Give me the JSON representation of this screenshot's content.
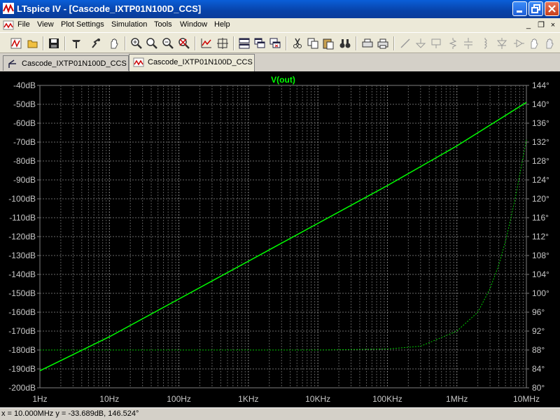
{
  "window": {
    "title": "LTspice IV - [Cascode_IXTP01N100D_CCS]",
    "accent": "#0a5fd8"
  },
  "menu": {
    "items": [
      "File",
      "View",
      "Plot Settings",
      "Simulation",
      "Tools",
      "Window",
      "Help"
    ],
    "mdi_buttons": [
      "_",
      "❐",
      "×"
    ]
  },
  "toolbar": {
    "icons": [
      "new-schematic-icon",
      "open-icon",
      "save-icon",
      "control-panel-icon",
      "run-icon",
      "pan-icon",
      "zoom-in-icon",
      "zoom-box-icon",
      "zoom-out-icon",
      "zoom-cancel-icon",
      "autorange-icon",
      "mark-plot-icon",
      "tile-horizontal-icon",
      "cascade-icon",
      "close-all-icon",
      "cut-icon",
      "copy-icon",
      "paste-icon",
      "find-icon",
      "print-setup-icon",
      "print-icon",
      "wire-icon",
      "ground-icon",
      "label-icon",
      "resistor-icon",
      "capacitor-icon",
      "inductor-icon",
      "diode-icon",
      "component-icon",
      "move-icon",
      "drag-icon"
    ]
  },
  "tabs": [
    {
      "label": "Cascode_IXTP01N100D_CCS",
      "active": false
    },
    {
      "label": "Cascode_IXTP01N100D_CCS",
      "active": true
    }
  ],
  "chart_data": {
    "type": "line",
    "title": "V(out)",
    "x_scale": "log",
    "xlim_hz": [
      1,
      10000000
    ],
    "x_tick_labels": [
      "1Hz",
      "10Hz",
      "100Hz",
      "1KHz",
      "10KHz",
      "100KHz",
      "1MHz",
      "10MHz"
    ],
    "y_left": {
      "range_db": [
        -200,
        -40
      ],
      "tick_labels": [
        "-40dB",
        "-50dB",
        "-60dB",
        "-70dB",
        "-80dB",
        "-90dB",
        "-100dB",
        "-110dB",
        "-120dB",
        "-130dB",
        "-140dB",
        "-150dB",
        "-160dB",
        "-170dB",
        "-180dB",
        "-190dB",
        "-200dB"
      ]
    },
    "y_right": {
      "range_deg": [
        80,
        144
      ],
      "tick_labels": [
        "144°",
        "140°",
        "136°",
        "132°",
        "128°",
        "124°",
        "120°",
        "116°",
        "112°",
        "108°",
        "104°",
        "100°",
        "96°",
        "92°",
        "88°",
        "84°",
        "80°"
      ]
    },
    "grid": true,
    "series": [
      {
        "name": "V(out)",
        "kind": "magnitude",
        "style": "solid",
        "color": "#00ff00",
        "x_hz": [
          1,
          10,
          100,
          1000,
          10000,
          100000,
          1000000,
          10000000
        ],
        "y_db": [
          -191,
          -173,
          -153,
          -133,
          -113,
          -93,
          -72,
          -49
        ]
      },
      {
        "kind": "phase",
        "style": "dashed",
        "color": "#00cc00",
        "x_hz": [
          1,
          10,
          100,
          1000,
          10000,
          100000,
          300000,
          1000000,
          2000000,
          3000000,
          4000000,
          5000000,
          6000000,
          7000000,
          8000000,
          9000000,
          10000000
        ],
        "y_deg": [
          88.0,
          88.0,
          88.0,
          88.0,
          88.0,
          88.2,
          88.8,
          92.0,
          96.0,
          101.0,
          106.0,
          111.0,
          116.0,
          120.5,
          125.0,
          129.0,
          132.5
        ]
      }
    ]
  },
  "status": {
    "cursor_readout": "x = 10.000MHz    y = -33.689dB, 146.524°"
  }
}
